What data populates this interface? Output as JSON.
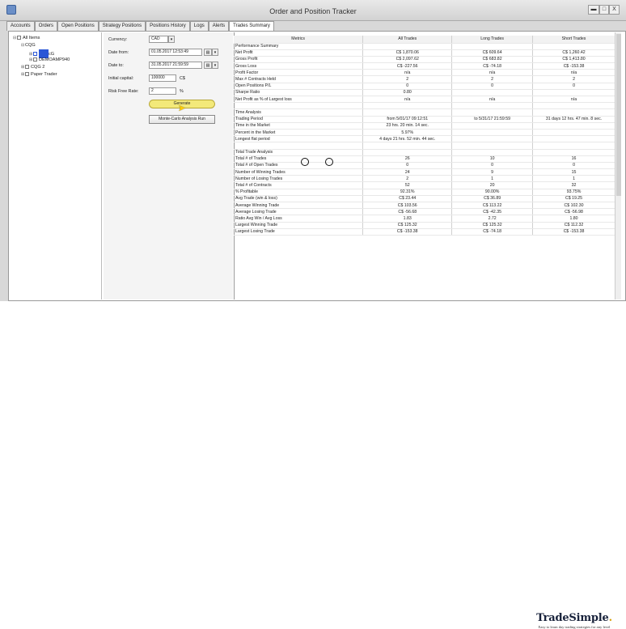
{
  "window": {
    "title": "Order and Position Tracker",
    "btn_min": "▬",
    "btn_max": "□",
    "btn_close": "X"
  },
  "tabs": [
    "Accounts",
    "Orders",
    "Open Positions",
    "Strategy Positions",
    "Positions History",
    "Logs",
    "Alerts",
    "Trades Summary"
  ],
  "active_tab": "Trades Summary",
  "tree": {
    "all_items": "All Items",
    "cqg1": "CQG",
    "cqg1_item": "cG",
    "demo": "DEMOAMP940",
    "cqg2": "CQG 2",
    "paper": "Paper Trader"
  },
  "form": {
    "currency_label": "Currency:",
    "currency_value": "CAD",
    "date_from_label": "Date from:",
    "date_from_value": "01.05.2017 12:53:49",
    "date_to_label": "Date to:",
    "date_to_value": "31.05.2017 21:59:59",
    "initial_capital_label": "Initial capital:",
    "initial_capital_value": "100000",
    "initial_capital_unit": "C$",
    "risk_free_label": "Risk Free Rate:",
    "risk_free_value": "2",
    "risk_free_unit": "%",
    "generate_button": "Generate",
    "monte_carlo_button": "Monte-Carlo Analysis Run"
  },
  "table": {
    "headers": [
      "Metrics",
      "All Trades",
      "Long Trades",
      "Short Trades"
    ],
    "rows": [
      [
        "Performance Summary",
        "",
        "",
        ""
      ],
      [
        "Net Profit",
        "C$ 1,870.06",
        "C$ 609.64",
        "C$ 1,260.42"
      ],
      [
        "Gross Profit",
        "C$ 2,097.62",
        "C$ 683.82",
        "C$ 1,413.80"
      ],
      [
        "Gross Loss",
        "C$ -227.56",
        "C$ -74.18",
        "C$ -153.38"
      ],
      [
        "Profit Factor",
        "n/a",
        "n/a",
        "n/a"
      ],
      [
        "Max # Contracts Held",
        "2",
        "2",
        "2"
      ],
      [
        "Open Positions P/L",
        "0",
        "0",
        "0"
      ],
      [
        "Sharpe Ratio",
        "0.80",
        "",
        ""
      ],
      [
        "Net Profit as % of Largest loss",
        "n/a",
        "n/a",
        "n/a"
      ],
      [
        "",
        "",
        "",
        ""
      ],
      [
        "Time Analysis",
        "",
        "",
        ""
      ],
      [
        "Trading Period",
        "from 5/01/17 09:12:51",
        "to 5/31/17 21:59:59",
        "31 days 12 hrs. 47 min. 8 sec."
      ],
      [
        "Time in the Market",
        "23 hrs. 20 min. 14 sec.",
        "",
        ""
      ],
      [
        "Percent in the Market",
        "5.97%",
        "",
        ""
      ],
      [
        "Longest flat period",
        "4 days 21 hrs. 52 min. 44 sec.",
        "",
        ""
      ],
      [
        "",
        "",
        "",
        ""
      ],
      [
        "Total Trade Analysis",
        "",
        "",
        ""
      ],
      [
        "Total # of Trades",
        "26",
        "10",
        "16"
      ],
      [
        "Total # of Open Trades",
        "0",
        "0",
        "0"
      ],
      [
        "Number of Winning Trades",
        "24",
        "9",
        "15"
      ],
      [
        "Number of Losing Trades",
        "2",
        "1",
        "1"
      ],
      [
        "Total # of Contracts",
        "52",
        "20",
        "32"
      ],
      [
        "% Profitable",
        "92.31%",
        "90.00%",
        "93.75%"
      ],
      [
        "Avg Trade (win & loss)",
        "C$ 23.44",
        "C$ 36.89",
        "C$ 19.25"
      ],
      [
        "Average Winning Trade",
        "C$ 103.56",
        "C$ 113.22",
        "C$ 102.30"
      ],
      [
        "Average Losing Trade",
        "C$ -56.68",
        "C$ -42.35",
        "C$ -56.98"
      ],
      [
        "Ratio Avg Win / Avg Loss",
        "1.83",
        "2.72",
        "1.80"
      ],
      [
        "Largest Winning Trade",
        "C$ 125.32",
        "C$ 125.32",
        "C$ 112.32"
      ],
      [
        "Largest Losing Trade",
        "C$ -153.38",
        "C$ -74.18",
        "C$ -153.38"
      ]
    ]
  },
  "logo": {
    "main": "TradeSimple",
    "dot": ".",
    "tagline": "Easy to learn day trading strategies for any level"
  },
  "colors": {
    "generate_button": "#f3e97a",
    "selection_blue": "#2a56d6",
    "cursor": "#ffcc00"
  }
}
